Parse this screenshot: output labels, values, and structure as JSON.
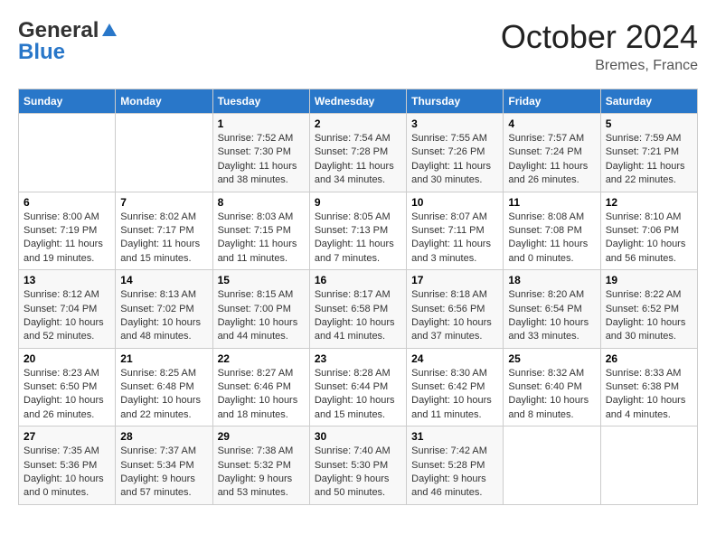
{
  "header": {
    "logo_line1": "General",
    "logo_line2": "Blue",
    "month": "October 2024",
    "location": "Bremes, France"
  },
  "weekdays": [
    "Sunday",
    "Monday",
    "Tuesday",
    "Wednesday",
    "Thursday",
    "Friday",
    "Saturday"
  ],
  "weeks": [
    [
      {
        "day": "",
        "info": ""
      },
      {
        "day": "",
        "info": ""
      },
      {
        "day": "1",
        "info": "Sunrise: 7:52 AM\nSunset: 7:30 PM\nDaylight: 11 hours and 38 minutes."
      },
      {
        "day": "2",
        "info": "Sunrise: 7:54 AM\nSunset: 7:28 PM\nDaylight: 11 hours and 34 minutes."
      },
      {
        "day": "3",
        "info": "Sunrise: 7:55 AM\nSunset: 7:26 PM\nDaylight: 11 hours and 30 minutes."
      },
      {
        "day": "4",
        "info": "Sunrise: 7:57 AM\nSunset: 7:24 PM\nDaylight: 11 hours and 26 minutes."
      },
      {
        "day": "5",
        "info": "Sunrise: 7:59 AM\nSunset: 7:21 PM\nDaylight: 11 hours and 22 minutes."
      }
    ],
    [
      {
        "day": "6",
        "info": "Sunrise: 8:00 AM\nSunset: 7:19 PM\nDaylight: 11 hours and 19 minutes."
      },
      {
        "day": "7",
        "info": "Sunrise: 8:02 AM\nSunset: 7:17 PM\nDaylight: 11 hours and 15 minutes."
      },
      {
        "day": "8",
        "info": "Sunrise: 8:03 AM\nSunset: 7:15 PM\nDaylight: 11 hours and 11 minutes."
      },
      {
        "day": "9",
        "info": "Sunrise: 8:05 AM\nSunset: 7:13 PM\nDaylight: 11 hours and 7 minutes."
      },
      {
        "day": "10",
        "info": "Sunrise: 8:07 AM\nSunset: 7:11 PM\nDaylight: 11 hours and 3 minutes."
      },
      {
        "day": "11",
        "info": "Sunrise: 8:08 AM\nSunset: 7:08 PM\nDaylight: 11 hours and 0 minutes."
      },
      {
        "day": "12",
        "info": "Sunrise: 8:10 AM\nSunset: 7:06 PM\nDaylight: 10 hours and 56 minutes."
      }
    ],
    [
      {
        "day": "13",
        "info": "Sunrise: 8:12 AM\nSunset: 7:04 PM\nDaylight: 10 hours and 52 minutes."
      },
      {
        "day": "14",
        "info": "Sunrise: 8:13 AM\nSunset: 7:02 PM\nDaylight: 10 hours and 48 minutes."
      },
      {
        "day": "15",
        "info": "Sunrise: 8:15 AM\nSunset: 7:00 PM\nDaylight: 10 hours and 44 minutes."
      },
      {
        "day": "16",
        "info": "Sunrise: 8:17 AM\nSunset: 6:58 PM\nDaylight: 10 hours and 41 minutes."
      },
      {
        "day": "17",
        "info": "Sunrise: 8:18 AM\nSunset: 6:56 PM\nDaylight: 10 hours and 37 minutes."
      },
      {
        "day": "18",
        "info": "Sunrise: 8:20 AM\nSunset: 6:54 PM\nDaylight: 10 hours and 33 minutes."
      },
      {
        "day": "19",
        "info": "Sunrise: 8:22 AM\nSunset: 6:52 PM\nDaylight: 10 hours and 30 minutes."
      }
    ],
    [
      {
        "day": "20",
        "info": "Sunrise: 8:23 AM\nSunset: 6:50 PM\nDaylight: 10 hours and 26 minutes."
      },
      {
        "day": "21",
        "info": "Sunrise: 8:25 AM\nSunset: 6:48 PM\nDaylight: 10 hours and 22 minutes."
      },
      {
        "day": "22",
        "info": "Sunrise: 8:27 AM\nSunset: 6:46 PM\nDaylight: 10 hours and 18 minutes."
      },
      {
        "day": "23",
        "info": "Sunrise: 8:28 AM\nSunset: 6:44 PM\nDaylight: 10 hours and 15 minutes."
      },
      {
        "day": "24",
        "info": "Sunrise: 8:30 AM\nSunset: 6:42 PM\nDaylight: 10 hours and 11 minutes."
      },
      {
        "day": "25",
        "info": "Sunrise: 8:32 AM\nSunset: 6:40 PM\nDaylight: 10 hours and 8 minutes."
      },
      {
        "day": "26",
        "info": "Sunrise: 8:33 AM\nSunset: 6:38 PM\nDaylight: 10 hours and 4 minutes."
      }
    ],
    [
      {
        "day": "27",
        "info": "Sunrise: 7:35 AM\nSunset: 5:36 PM\nDaylight: 10 hours and 0 minutes."
      },
      {
        "day": "28",
        "info": "Sunrise: 7:37 AM\nSunset: 5:34 PM\nDaylight: 9 hours and 57 minutes."
      },
      {
        "day": "29",
        "info": "Sunrise: 7:38 AM\nSunset: 5:32 PM\nDaylight: 9 hours and 53 minutes."
      },
      {
        "day": "30",
        "info": "Sunrise: 7:40 AM\nSunset: 5:30 PM\nDaylight: 9 hours and 50 minutes."
      },
      {
        "day": "31",
        "info": "Sunrise: 7:42 AM\nSunset: 5:28 PM\nDaylight: 9 hours and 46 minutes."
      },
      {
        "day": "",
        "info": ""
      },
      {
        "day": "",
        "info": ""
      }
    ]
  ]
}
